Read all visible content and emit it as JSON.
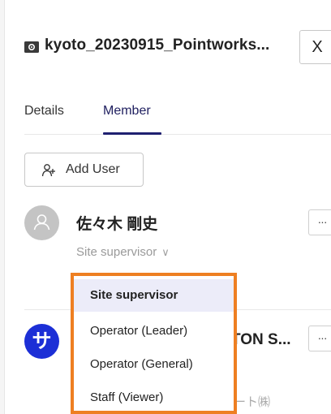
{
  "header": {
    "title": "kyoto_20230915_Pointworks...",
    "close_label": "X"
  },
  "tabs": [
    {
      "label": "Details",
      "active": false
    },
    {
      "label": "Member",
      "active": true
    }
  ],
  "add_user": {
    "label": "Add User",
    "icon": "add-user-icon"
  },
  "members": [
    {
      "name": "佐々木 剛史",
      "role": "Site supervisor",
      "avatar_color": "#c4c4c4",
      "more_label": "···"
    },
    {
      "avatar_glyph": "サ",
      "avatar_color": "#1c2fd6",
      "name_visible": "TON S...",
      "company_visible": "ート㈱",
      "more_label": "···"
    }
  ],
  "role_dropdown": {
    "selected": "Site supervisor",
    "options": [
      "Site supervisor",
      "Operator (Leader)",
      "Operator (General)",
      "Staff (Viewer)"
    ],
    "highlight_color": "#ee7f22"
  },
  "colors": {
    "accent": "#1f2070",
    "selected_bg": "#ececf9"
  }
}
